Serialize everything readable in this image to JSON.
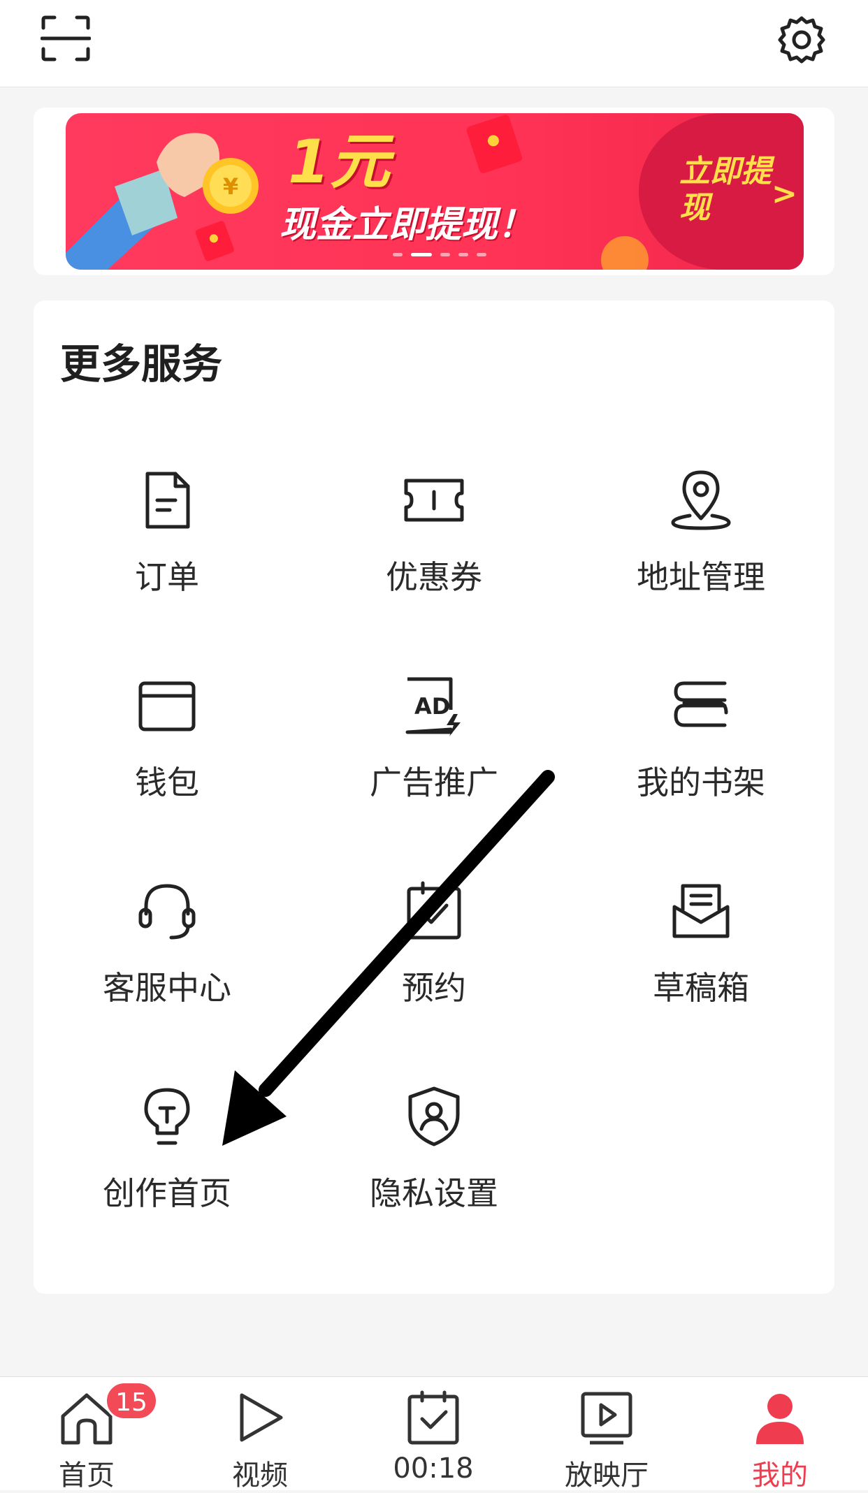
{
  "banner": {
    "amount": "1元",
    "subtitle": "现金立即提现！",
    "cta": "立即提现",
    "cta_arrow": ">"
  },
  "services": {
    "title": "更多服务",
    "items": [
      {
        "label": "订单",
        "icon": "order-document-icon"
      },
      {
        "label": "优惠券",
        "icon": "coupon-ticket-icon"
      },
      {
        "label": "地址管理",
        "icon": "location-pin-icon"
      },
      {
        "label": "钱包",
        "icon": "wallet-icon"
      },
      {
        "label": "广告推广",
        "icon": "ad-promotion-icon"
      },
      {
        "label": "我的书架",
        "icon": "bookshelf-icon"
      },
      {
        "label": "客服中心",
        "icon": "headset-icon"
      },
      {
        "label": "预约",
        "icon": "calendar-check-icon"
      },
      {
        "label": "草稿箱",
        "icon": "draft-inbox-icon"
      },
      {
        "label": "创作首页",
        "icon": "lightbulb-icon"
      },
      {
        "label": "隐私设置",
        "icon": "shield-user-icon"
      }
    ]
  },
  "tabbar": {
    "tabs": [
      {
        "label": "首页",
        "icon": "home-icon",
        "badge": "15"
      },
      {
        "label": "视频",
        "icon": "play-icon"
      },
      {
        "label": "00:18",
        "icon": "calendar-check-icon"
      },
      {
        "label": "放映厅",
        "icon": "screen-play-icon"
      },
      {
        "label": "我的",
        "icon": "user-icon"
      }
    ],
    "active_color": "#ef3c4e"
  },
  "colors": {
    "banner_red": "#ff3a5e",
    "banner_yellow": "#ffe04a",
    "accent": "#ef3c4e"
  }
}
